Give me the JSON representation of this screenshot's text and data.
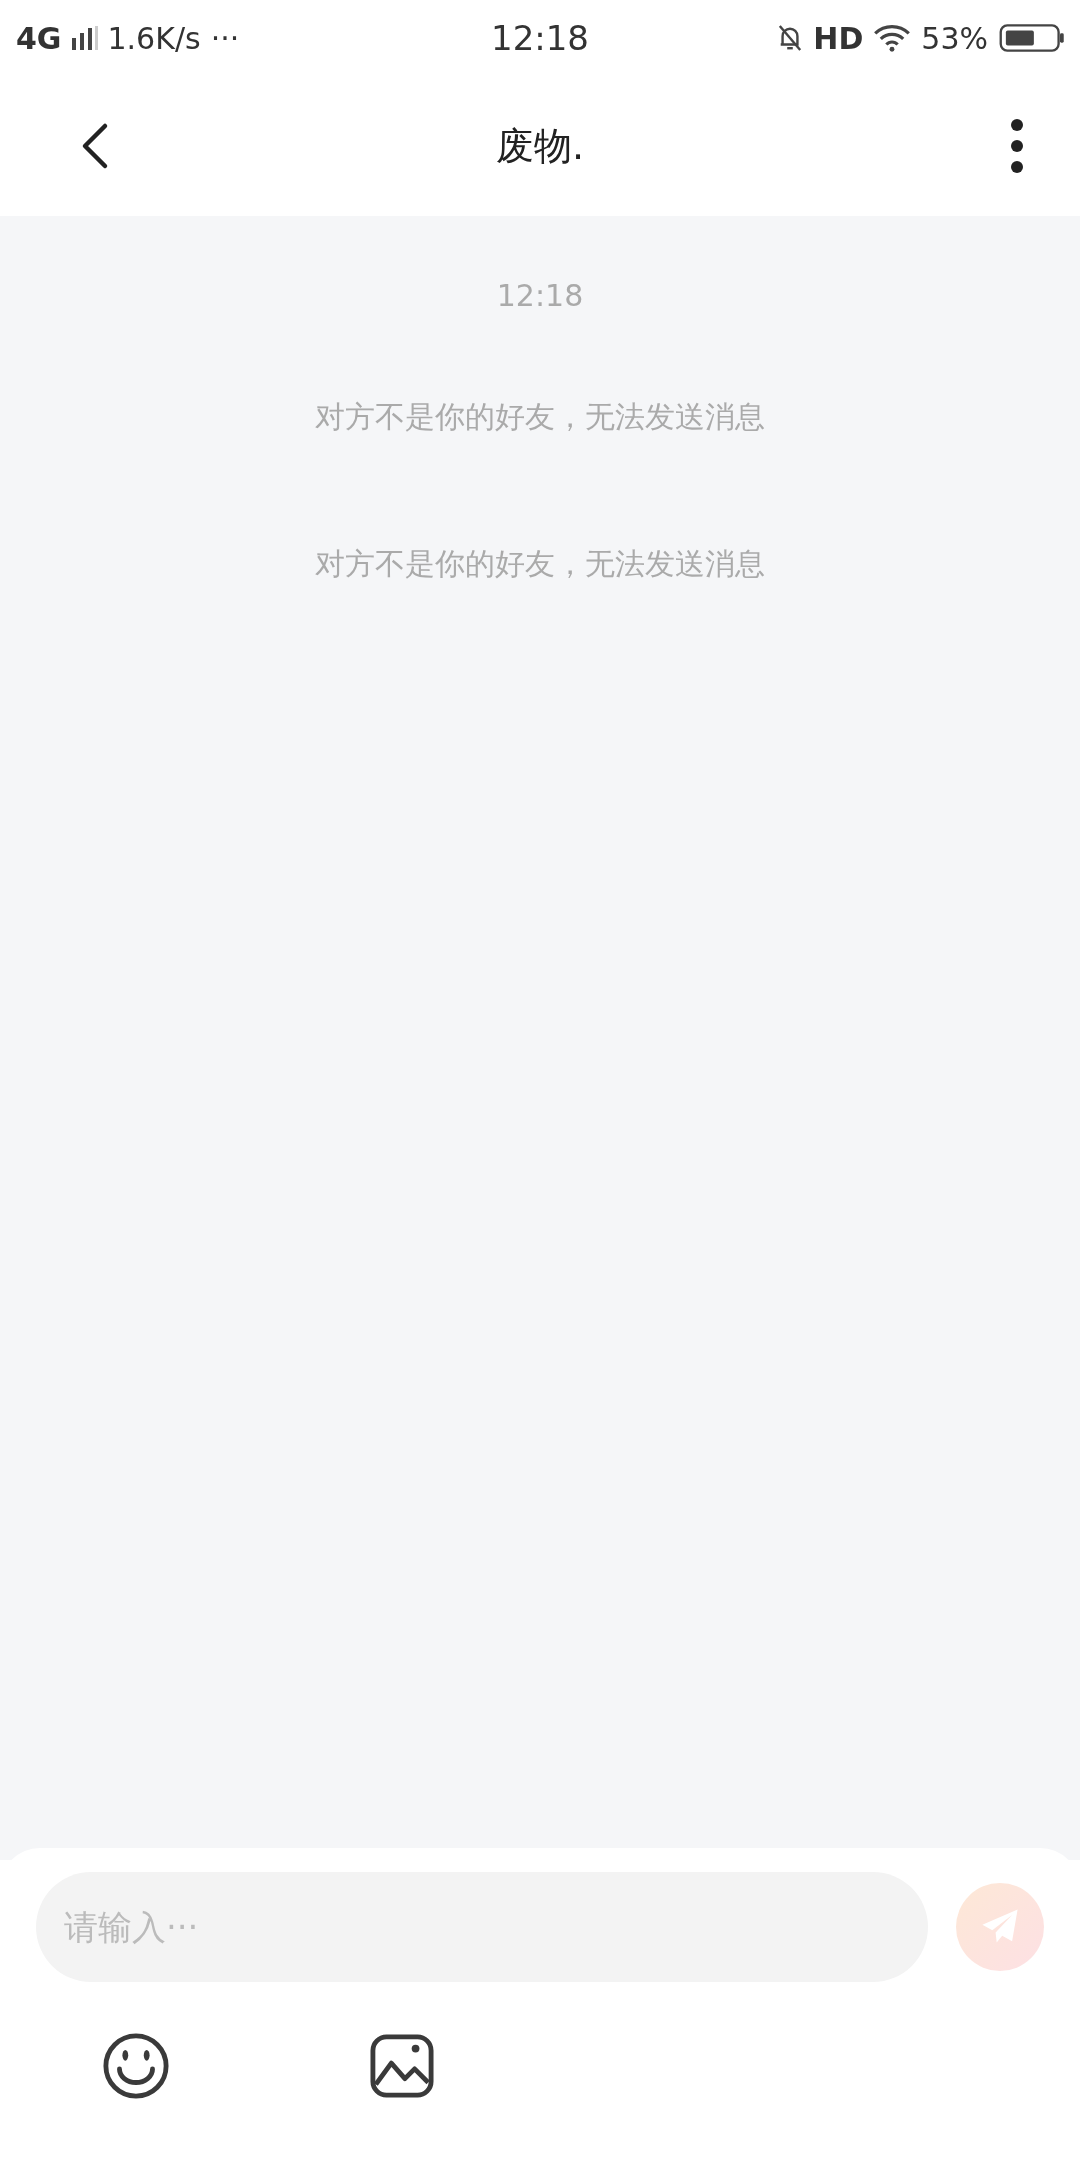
{
  "status_bar": {
    "network": "4G",
    "speed": "1.6K/s",
    "more": "···",
    "time": "12:18",
    "hd": "HD",
    "battery": "53%"
  },
  "header": {
    "title": "废物."
  },
  "messages": [
    {
      "kind": "time",
      "text": "12:18"
    },
    {
      "kind": "notice",
      "text": "对方不是你的好友，无法发送消息"
    },
    {
      "kind": "notice",
      "text": "对方不是你的好友，无法发送消息"
    }
  ],
  "composer": {
    "placeholder": "请输入···",
    "send_disabled": true
  }
}
